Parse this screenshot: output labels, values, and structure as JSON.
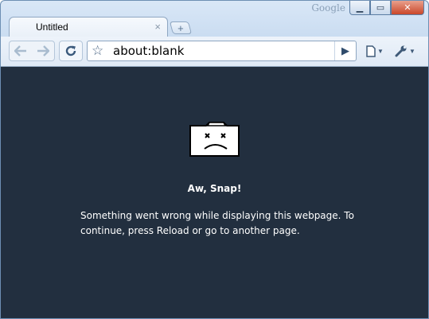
{
  "window": {
    "brand": "Google",
    "controls": {
      "minimize": "▁",
      "maximize": "▭",
      "close": "✕"
    }
  },
  "tabs": [
    {
      "title": "Untitled",
      "close_icon": "×"
    }
  ],
  "new_tab_icon": "+",
  "toolbar": {
    "back_icon": "arrow-left-icon",
    "forward_icon": "arrow-right-icon",
    "reload_icon": "reload-icon",
    "bookmark_icon": "star-icon",
    "url": "about:blank",
    "go_icon": "play-icon",
    "page_menu_icon": "page-icon",
    "wrench_menu_icon": "wrench-icon"
  },
  "content": {
    "title": "Aw, Snap!",
    "message": "Something went wrong while displaying this webpage. To continue, press Reload or go to another page."
  },
  "colors": {
    "content_background": "#222f3f",
    "frame": "#c5d9ef"
  }
}
